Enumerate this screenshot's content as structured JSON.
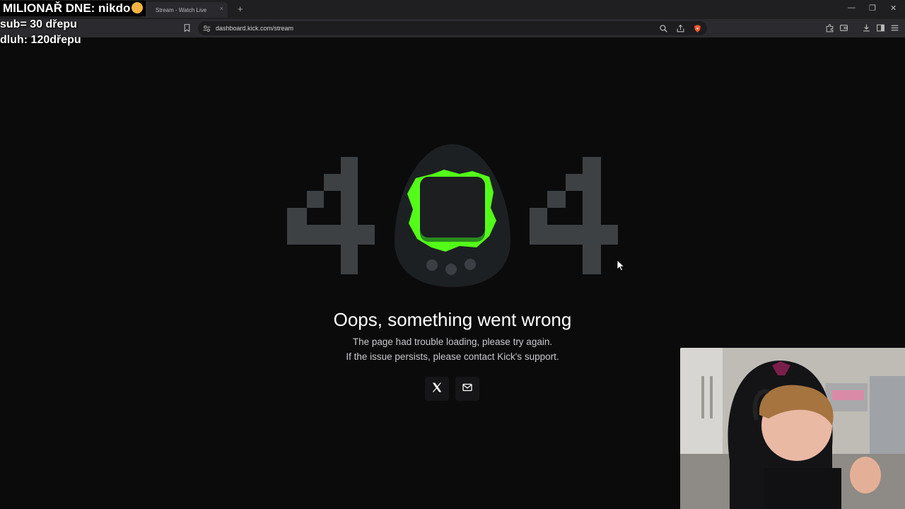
{
  "browser": {
    "tab_title": "Stream - Watch Live",
    "url": "dashboard.kick.com/stream",
    "new_tab": "+",
    "close_tab": "×",
    "minimize": "—",
    "restore": "❐",
    "close": "✕"
  },
  "overlay": {
    "line1": "MILIONAŘ DNE: nikdo",
    "line2": "sub= 30 dřepu",
    "line3": "dluh: 120dřepu"
  },
  "error": {
    "code": "404",
    "title": "Oops, something went wrong",
    "line1": "The page had trouble loading, please try again.",
    "line2": "If the issue persists, please contact Kick's support."
  },
  "social": {
    "x_label": "X",
    "mail_label": "Email"
  },
  "colors": {
    "accent": "#53fc18",
    "background": "#0b0b0c",
    "digit": "#3d4144",
    "egg": "#1d2023"
  }
}
